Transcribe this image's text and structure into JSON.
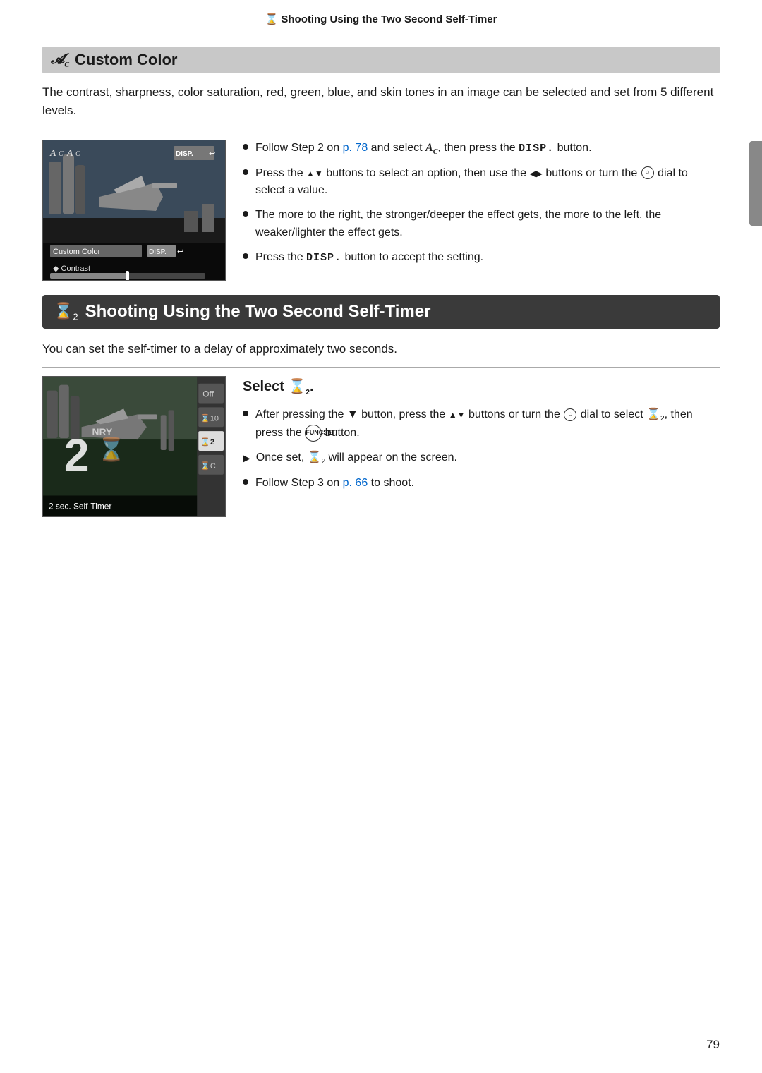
{
  "header": {
    "text": "Shooting Using the Two Second Self-Timer"
  },
  "custom_color_section": {
    "icon_text": "Ac",
    "title": "Custom Color",
    "description": "The contrast, sharpness, color saturation, red, green, blue, and skin tones in an image can be selected and set from 5 different levels.",
    "bullet_1": {
      "text_before": "Follow Step 2 on ",
      "link_text": "p. 78",
      "text_middle": " and select ",
      "icon": "Ac",
      "text_after": ", then press the ",
      "button": "DISP.",
      "text_end": " button."
    },
    "bullet_2": {
      "text": "Press the ▲▼ buttons to select an option, then use the ◀▶ buttons or turn the dial to select a value."
    },
    "bullet_3": {
      "text": "The more to the right, the stronger/deeper the effect gets, the more to the left, the weaker/lighter the effect gets."
    },
    "bullet_4": {
      "text_before": "Press the ",
      "button": "DISP.",
      "text_after": " button to accept the setting."
    },
    "camera_labels": {
      "top_left": "Ac Ac",
      "menu_item_1": "Custom Color",
      "menu_item_2": "◆ Contrast",
      "disp_badge": "DISP.↩"
    }
  },
  "self_timer_section": {
    "icon_text": "⊙2",
    "title": "Shooting Using the Two Second Self-Timer",
    "description": "You can set the self-timer to a delay of approximately two seconds.",
    "select_label": "Select ⊙2.",
    "bullet_1": {
      "text": "After pressing the ▼ button, press the ▲▼ buttons or turn the dial to select ⊙2, then press the FUNC/SET button."
    },
    "bullet_2": {
      "text_before": "Once set, ⊙2 will appear on the screen."
    },
    "bullet_3": {
      "text_before": "Follow Step 3 on ",
      "link_text": "p. 66",
      "text_after": " to shoot."
    },
    "camera_label": "2 sec. Self-Timer",
    "menu_items": [
      "Off",
      "⊙10",
      "⊙2",
      "⊙C"
    ]
  },
  "page_number": "79"
}
